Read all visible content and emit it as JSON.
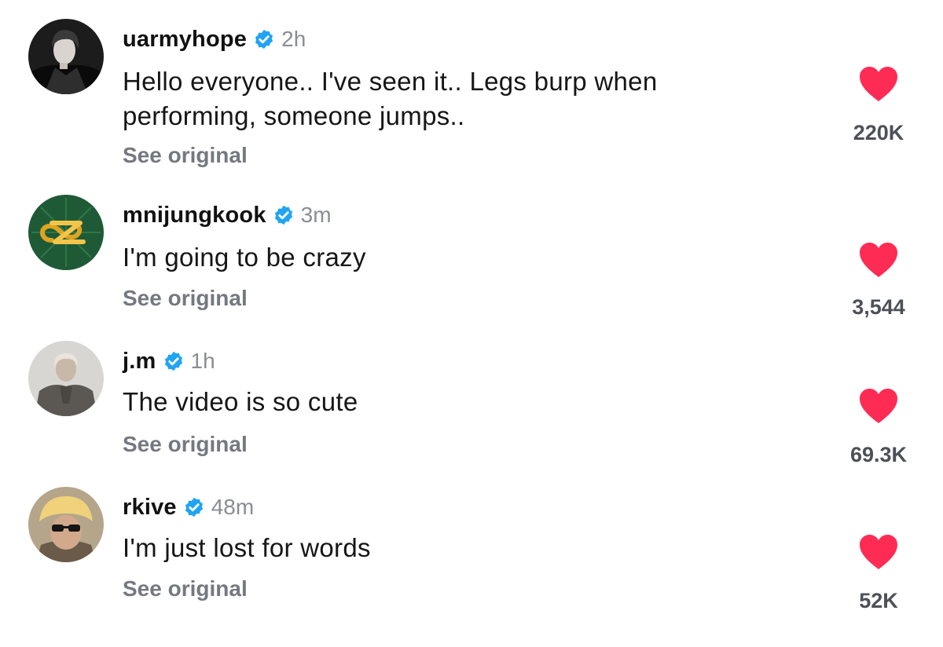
{
  "colors": {
    "heart": "#fe2c55",
    "verified": "#20a4f3",
    "muted_text": "#8a8d93",
    "see_original": "#747880",
    "like_count": "#4d5058"
  },
  "comments": [
    {
      "username": "uarmyhope",
      "verified": true,
      "time": "2h",
      "text": "Hello everyone.. I've seen it.. Legs burp when performing, someone jumps..",
      "see_original": "See original",
      "likes": "220K",
      "liked": true,
      "avatar_icon": "user-avatar-photo"
    },
    {
      "username": "mnijungkook",
      "verified": true,
      "time": "3m",
      "text": "I'm going to be crazy",
      "see_original": "See original",
      "likes": "3,544",
      "liked": true,
      "avatar_icon": "user-avatar-logo"
    },
    {
      "username": "j.m",
      "verified": true,
      "time": "1h",
      "text": "The video is so cute",
      "see_original": "See original",
      "likes": "69.3K",
      "liked": true,
      "avatar_icon": "user-avatar-photo"
    },
    {
      "username": "rkive",
      "verified": true,
      "time": "48m",
      "text": "I'm just lost for words",
      "see_original": "See original",
      "likes": "52K",
      "liked": true,
      "avatar_icon": "user-avatar-photo"
    }
  ]
}
